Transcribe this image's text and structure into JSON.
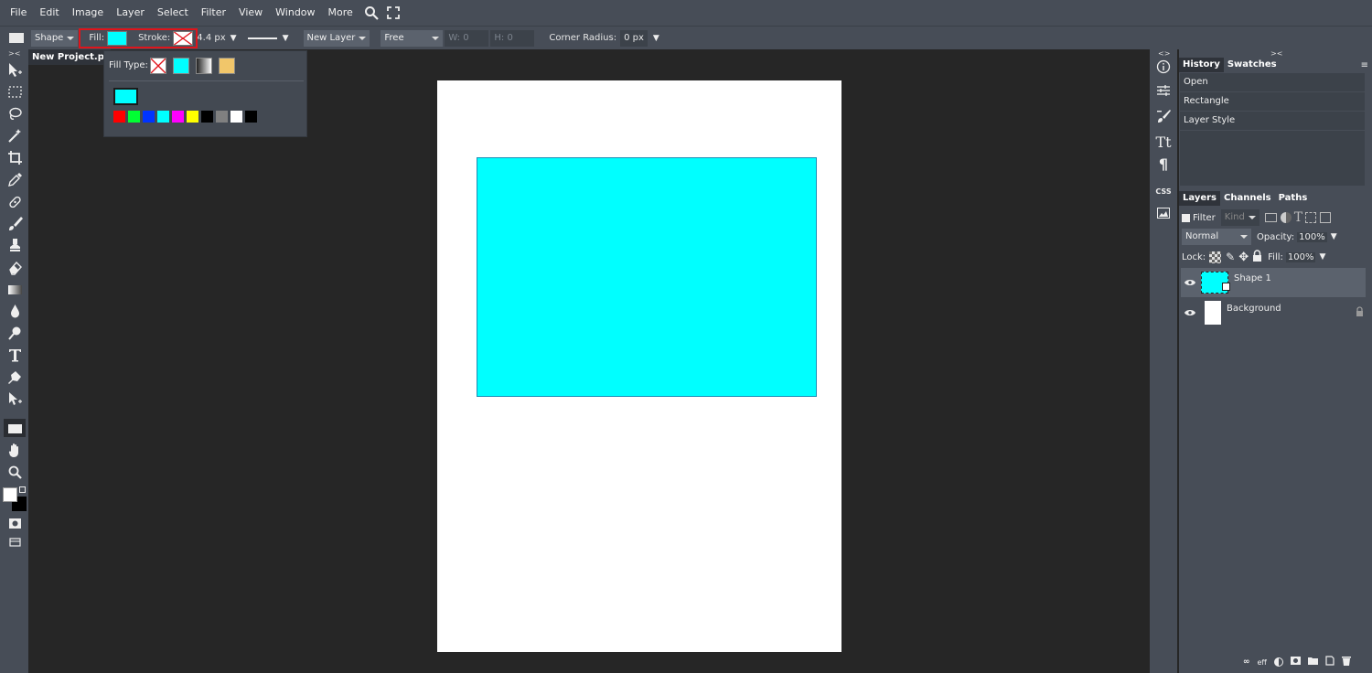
{
  "menu": {
    "items": [
      "File",
      "Edit",
      "Image",
      "Layer",
      "Select",
      "Filter",
      "View",
      "Window",
      "More"
    ],
    "search_icon": "search-icon",
    "fullscreen_icon": "fullscreen-icon"
  },
  "options": {
    "mode": "Shape",
    "fill_label": "Fill:",
    "stroke_label": "Stroke:",
    "stroke_width": "4.4 px",
    "layer_mode": "New Layer",
    "constraint": "Free",
    "w_label": "W:",
    "w_value": "0",
    "h_label": "H:",
    "h_value": "0",
    "corner_radius_label": "Corner Radius:",
    "corner_radius_value": "0 px",
    "fill_color": "#00ffff"
  },
  "document": {
    "tab_title": "New Project.psd",
    "shape_color": "#00ffff"
  },
  "fill_popup": {
    "label": "Fill Type:",
    "current_color": "#00ffff",
    "swatches": [
      "#ff0000",
      "#00ff33",
      "#0033ff",
      "#00ffff",
      "#ff00ff",
      "#ffff00",
      "#000000",
      "#808080",
      "#ffffff",
      "#000000"
    ]
  },
  "history": {
    "tabs": [
      "History",
      "Swatches"
    ],
    "items": [
      "Open",
      "Rectangle",
      "Layer Style"
    ]
  },
  "layers": {
    "tabs": [
      "Layers",
      "Channels",
      "Paths"
    ],
    "filter_label": "Filter",
    "kind_label": "Kind",
    "blend_mode": "Normal",
    "opacity_label": "Opacity:",
    "opacity_value": "100%",
    "lock_label": "Lock:",
    "fill_label": "Fill:",
    "fill_value": "100%",
    "items": [
      {
        "name": "Shape 1"
      },
      {
        "name": "Background"
      }
    ],
    "footer_fx": "eff"
  },
  "right_strip": {
    "css_label": "CSS"
  }
}
